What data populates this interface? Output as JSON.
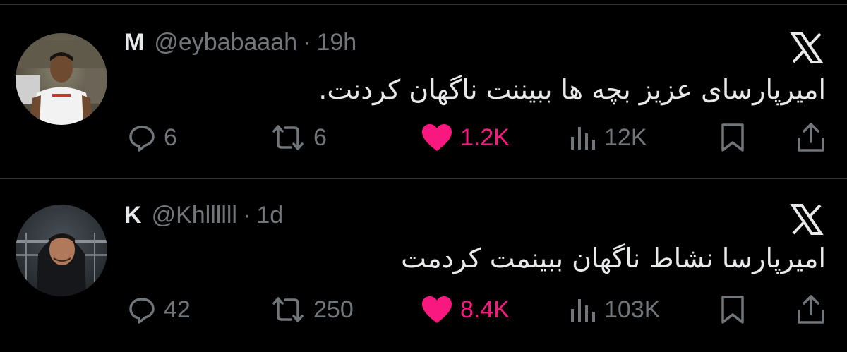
{
  "theme": {
    "background": "#000000",
    "text": "#e7e9ea",
    "secondary": "#71767b",
    "like": "#f91880",
    "divider": "#2f3336"
  },
  "tweets": [
    {
      "display_name": "M",
      "handle": "@eybabaaah",
      "separator": "·",
      "time": "19h",
      "text": "امیرپارسای عزیز بچه ها ببیننت ناگهان کردنت.",
      "replies": "6",
      "retweets": "6",
      "likes": "1.2K",
      "views": "12K",
      "avatar_icon": "person-white-shirt-avatar"
    },
    {
      "display_name": "K",
      "handle": "@Khllllll",
      "separator": "·",
      "time": "1d",
      "text": "امیرپارسا نشاط ناگهان ببینمت کردمت",
      "replies": "42",
      "retweets": "250",
      "likes": "8.4K",
      "views": "103K",
      "avatar_icon": "person-black-hoodie-avatar"
    }
  ],
  "icons": {
    "platform": "x-logo-icon",
    "reply": "reply-bubble-icon",
    "retweet": "retweet-icon",
    "like": "heart-filled-icon",
    "views": "views-bars-icon",
    "bookmark": "bookmark-icon",
    "share": "share-icon"
  }
}
